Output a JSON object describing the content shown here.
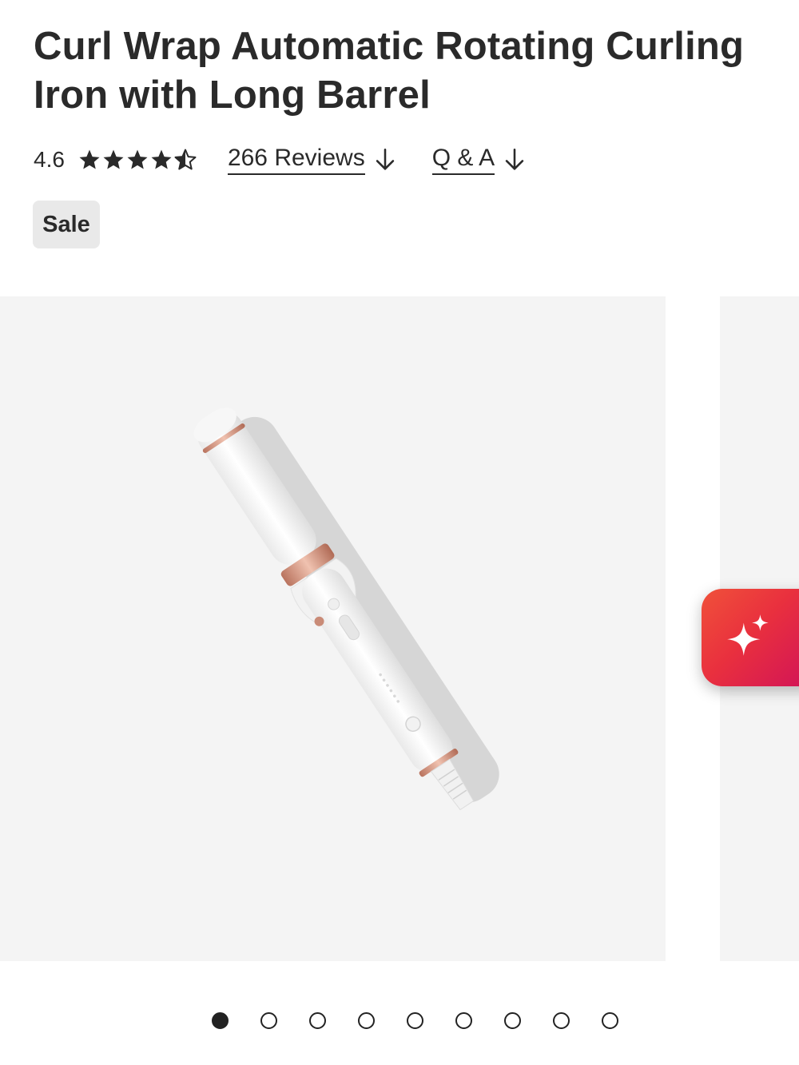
{
  "product": {
    "title": "Curl Wrap Automatic Rotating Curling Iron with Long Barrel"
  },
  "rating": {
    "value": "4.6",
    "stars_filled": 4.6,
    "stars_max": 5,
    "icon": "star-icon"
  },
  "links": {
    "reviews_label": "266 Reviews",
    "qa_label": "Q & A",
    "arrow_icon": "arrow-down-icon"
  },
  "badge": {
    "sale_label": "Sale"
  },
  "gallery": {
    "image_subject": "white curling iron with rose gold accents",
    "slide_count": 9,
    "active_index": 0,
    "background_color": "#f4f4f4"
  },
  "ai_assistant": {
    "icon": "sparkle-icon",
    "gradient_start": "#f0513a",
    "gradient_end": "#d11358"
  },
  "colors": {
    "text": "#2a2a2a",
    "badge_bg": "#e9e9e9",
    "accent_rose_gold": "#d69a86"
  }
}
